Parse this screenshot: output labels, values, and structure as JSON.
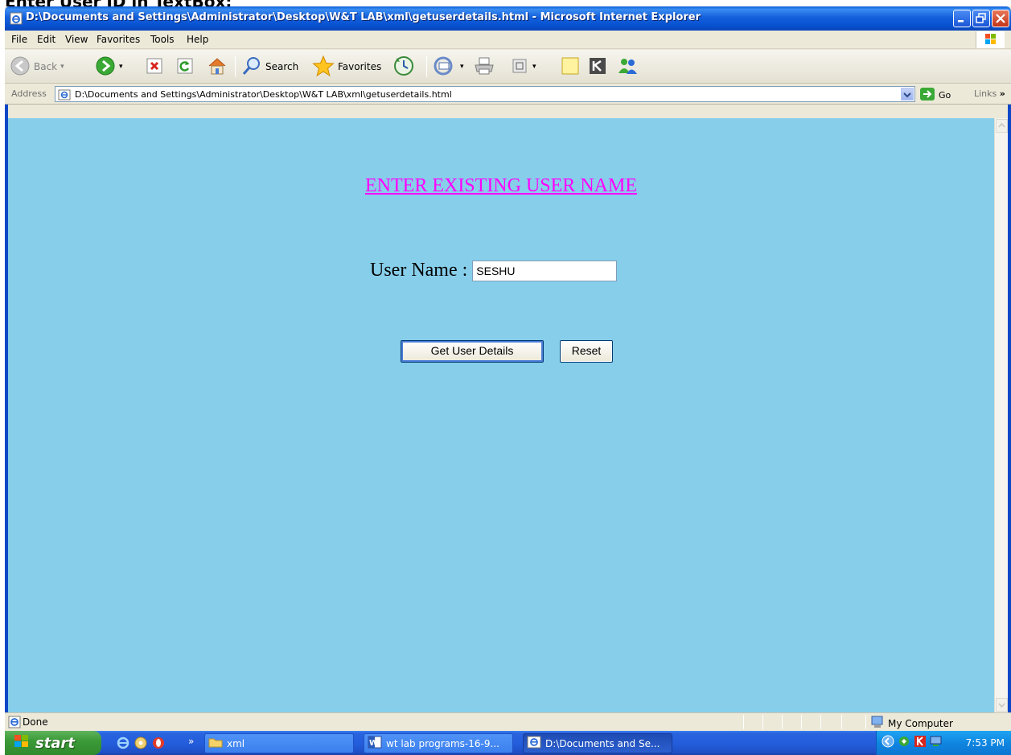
{
  "doc_heading": "Enter User ID in TextBox:",
  "window": {
    "title": "D:\\Documents and Settings\\Administrator\\Desktop\\W&T LAB\\xml\\getuserdetails.html - Microsoft Internet Explorer"
  },
  "menu": {
    "items": [
      "File",
      "Edit",
      "View",
      "Favorites",
      "Tools",
      "Help"
    ]
  },
  "toolbar": {
    "back_label": "Back",
    "search_label": "Search",
    "favorites_label": "Favorites"
  },
  "address": {
    "label": "Address",
    "url": "D:\\Documents and Settings\\Administrator\\Desktop\\W&T LAB\\xml\\getuserdetails.html",
    "go_label": "Go",
    "links_label": "Links"
  },
  "page": {
    "heading": "ENTER EXISTING USER NAME",
    "field_label": "User Name",
    "colon": ":",
    "username_value": "SESHU",
    "submit_label": "Get User Details",
    "reset_label": "Reset",
    "background": "#87ceea",
    "heading_color": "#ff00ff"
  },
  "status": {
    "text": "Done",
    "zone": "My Computer"
  },
  "taskbar": {
    "start_label": "start",
    "tasks": [
      {
        "label": "xml",
        "icon": "folder-icon"
      },
      {
        "label": "wt lab programs-16-9...",
        "icon": "word-icon"
      },
      {
        "label": "D:\\Documents and Se...",
        "icon": "ie-icon"
      }
    ],
    "clock": "7:53 PM"
  }
}
